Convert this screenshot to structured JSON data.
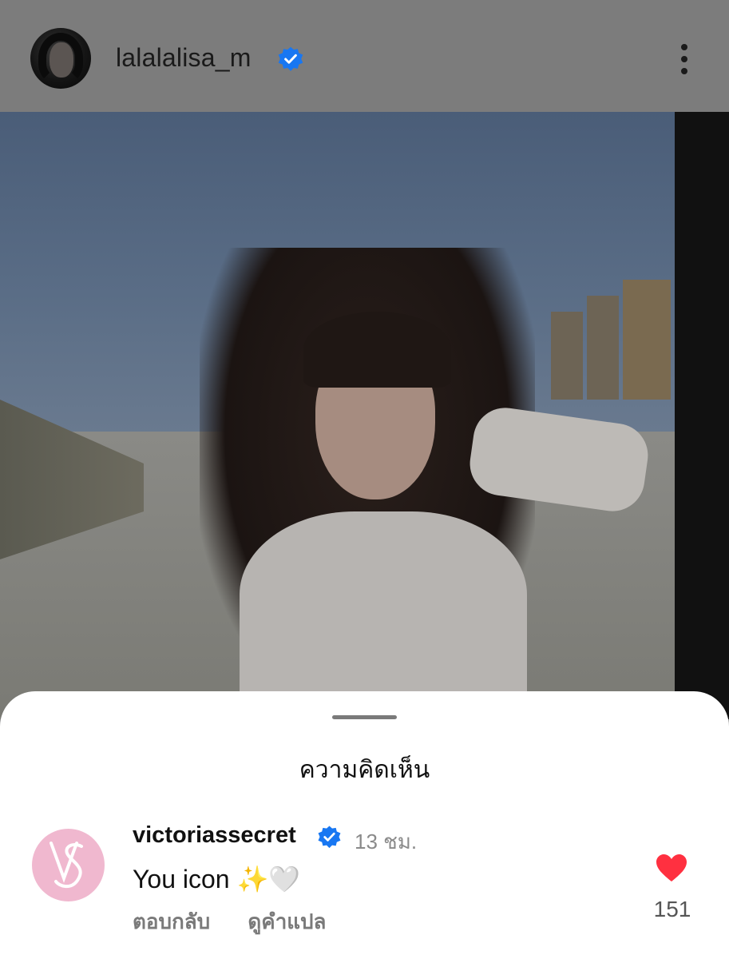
{
  "header": {
    "username": "lalalalisa_m",
    "verified": true
  },
  "post": {
    "image": "photo of woman with dark wavy hair and bangs in white outfit with fingerless glove, outdoor lot"
  },
  "comments_sheet": {
    "title": "ความคิดเห็น",
    "comment": {
      "username": "victoriassecret",
      "verified": true,
      "time": "13 ชม.",
      "text": "You icon ✨🤍",
      "reply_label": "ตอบกลับ",
      "translate_label": "ดูคำแปล",
      "like_count": "151"
    }
  },
  "colors": {
    "verified_blue": "#1877f2",
    "heart_red": "#ff3040",
    "vs_pink": "#f0b8cf"
  }
}
